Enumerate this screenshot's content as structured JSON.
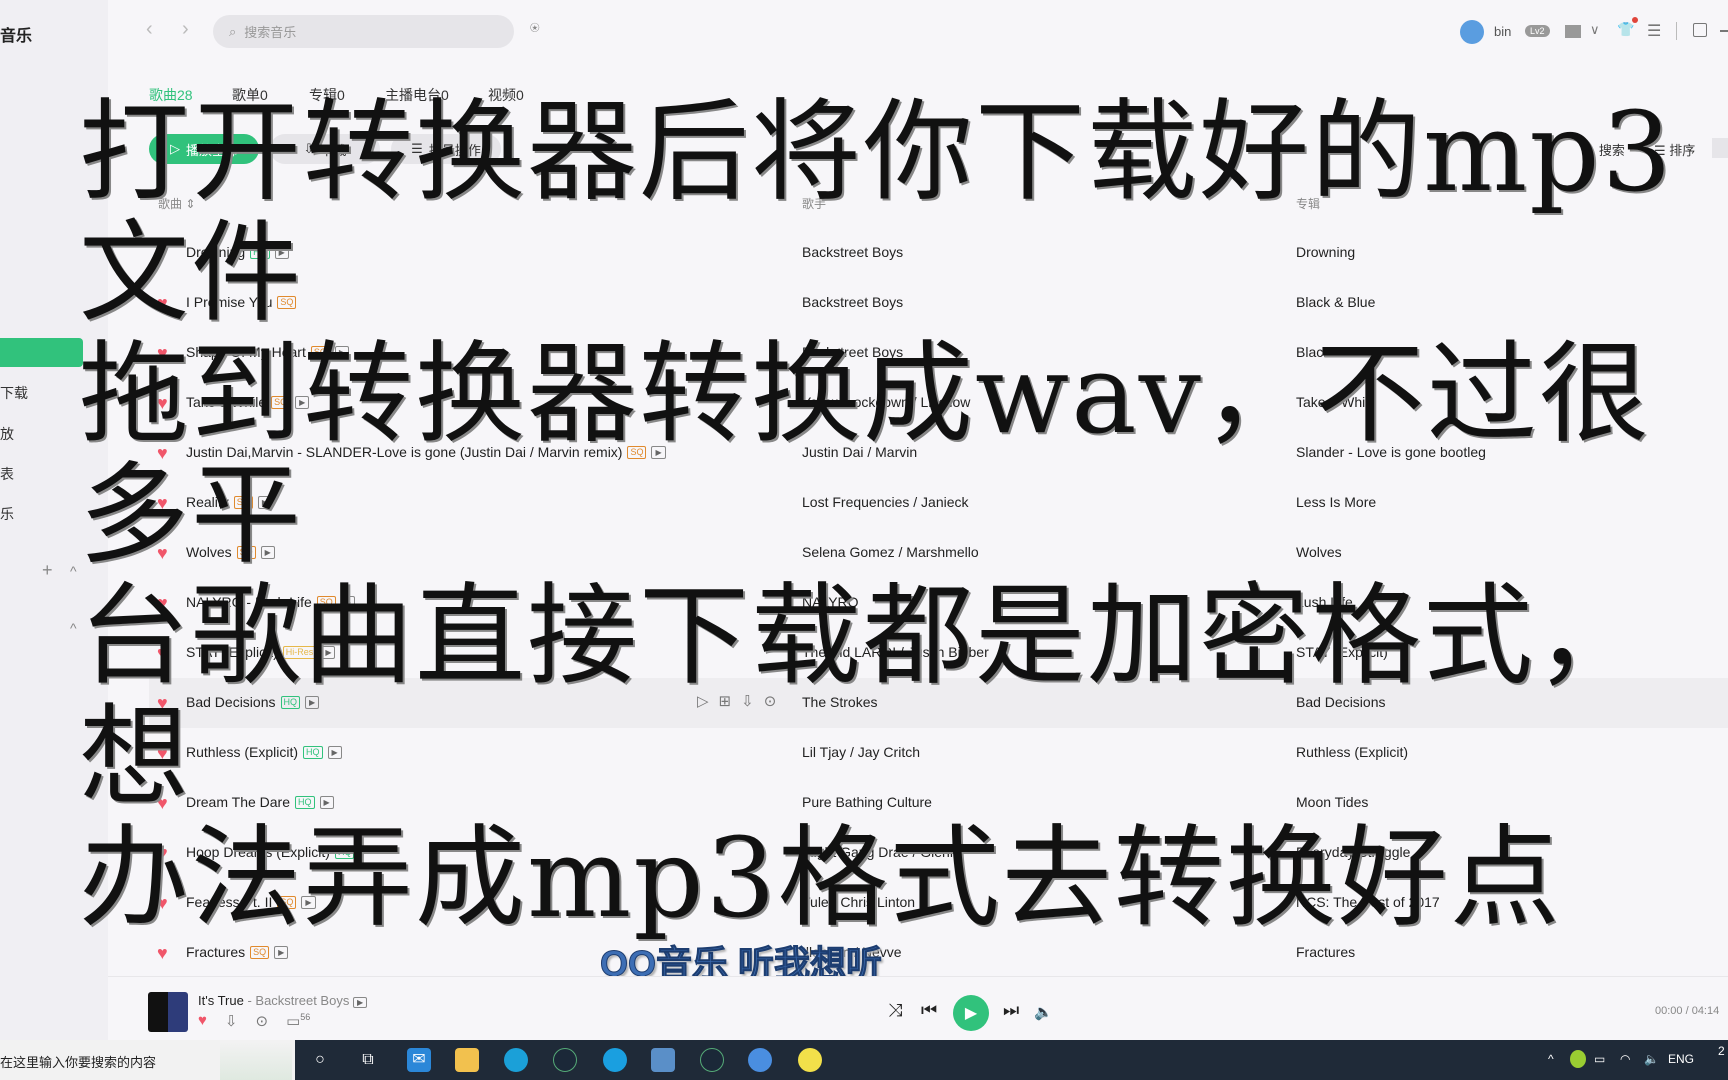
{
  "app": {
    "title": "音乐",
    "accent": "#31c27c"
  },
  "sidebar": {
    "items": [
      {
        "label": "下载"
      },
      {
        "label": "放"
      },
      {
        "label": "表"
      },
      {
        "label": "乐"
      }
    ],
    "add": "+",
    "collapse": "^"
  },
  "header": {
    "search_placeholder": "搜索音乐",
    "user": "bin",
    "level": "Lv2"
  },
  "tabs": [
    {
      "label": "歌曲28"
    },
    {
      "label": "歌单0"
    },
    {
      "label": "专辑0"
    },
    {
      "label": "主播电台0"
    },
    {
      "label": "视频0"
    }
  ],
  "actions": {
    "play_all": "播放全部",
    "download": "下载",
    "batch": "批量操作",
    "search": "搜索",
    "sort": "排序"
  },
  "columns": {
    "title": "歌曲",
    "artist": "歌手",
    "album": "专辑"
  },
  "songs": [
    {
      "title": "Drowning",
      "quality": "HQ",
      "mv": true,
      "artist": "Backstreet Boys",
      "album": "Drowning"
    },
    {
      "title": "I Promise You",
      "quality": "SQ",
      "mv": false,
      "artist": "Backstreet Boys",
      "album": "Black & Blue"
    },
    {
      "title": "Shape Of My Heart",
      "quality": "SQ",
      "mv": true,
      "artist": "Backstreet Boys",
      "album": "Black & Blue"
    },
    {
      "title": "Take a While",
      "quality": "SQ",
      "mv": true,
      "artist": "Yellow Lockdown / Licellow",
      "album": "Take a While"
    },
    {
      "title": "Justin Dai,Marvin - SLANDER-Love is gone (Justin Dai  /  Marvin remix)",
      "quality": "SQ",
      "mv": true,
      "artist": "Justin Dai / Marvin",
      "album": "Slander - Love is gone bootleg"
    },
    {
      "title": "Reality",
      "quality": "SQ",
      "mv": true,
      "artist": "Lost Frequencies / Janieck",
      "album": "Less Is More"
    },
    {
      "title": "Wolves",
      "quality": "SQ",
      "mv": true,
      "artist": "Selena Gomez / Marshmello",
      "album": "Wolves"
    },
    {
      "title": "NALYRO - Lush Life",
      "quality": "SQ",
      "mv": true,
      "artist": "NALYRO",
      "album": "Lush Life"
    },
    {
      "title": "STAY (Explicit)",
      "quality": "Hi-Res",
      "mv": true,
      "artist": "The Kid LAROI / Justin Bieber",
      "album": "STAY (Explicit)"
    },
    {
      "title": "Bad Decisions",
      "quality": "HQ",
      "mv": true,
      "artist": "The Strokes",
      "album": "Bad Decisions",
      "hover": true
    },
    {
      "title": "Ruthless (Explicit)",
      "quality": "HQ",
      "mv": true,
      "artist": "Lil Tjay / Jay Critch",
      "album": "Ruthless (Explicit)"
    },
    {
      "title": "Dream The Dare",
      "quality": "HQ",
      "mv": true,
      "artist": "Pure Bathing Culture",
      "album": "Moon Tides"
    },
    {
      "title": "Hoop Dreams (Explicit)",
      "quality": "HQ",
      "mv": false,
      "artist": "Flight Gang Drae / Glenn",
      "album": "Everyday Struggle"
    },
    {
      "title": "Fearless Pt. II",
      "quality": "SQ",
      "mv": true,
      "artist": "Tule / Chris Linton",
      "album": "NCS: The Best of 2017"
    },
    {
      "title": "Fractures",
      "quality": "SQ",
      "mv": true,
      "artist": "Illenium / Nevve",
      "album": "Fractures"
    }
  ],
  "quality_colors": {
    "HQ": "#31c27c",
    "SQ": "#e08a2e",
    "Hi-Res": "#e6b84a"
  },
  "overlay": {
    "lines": [
      "打开转换器后将你下载好的mp3文件",
      "拖到转换器转换成wav，不过很多平",
      "台歌曲直接下载都是加密格式，想",
      "办法弄成mp3格式去转换好点"
    ]
  },
  "watermark": "QQ音乐 听我想听",
  "player": {
    "title": "It's True",
    "separator": " - ",
    "artist": "Backstreet Boys",
    "comments": "56",
    "time": "00:00 / 04:14"
  },
  "taskbar": {
    "search_placeholder": "在这里输入你要搜索的内容",
    "lang": "ENG",
    "clock": "2"
  }
}
